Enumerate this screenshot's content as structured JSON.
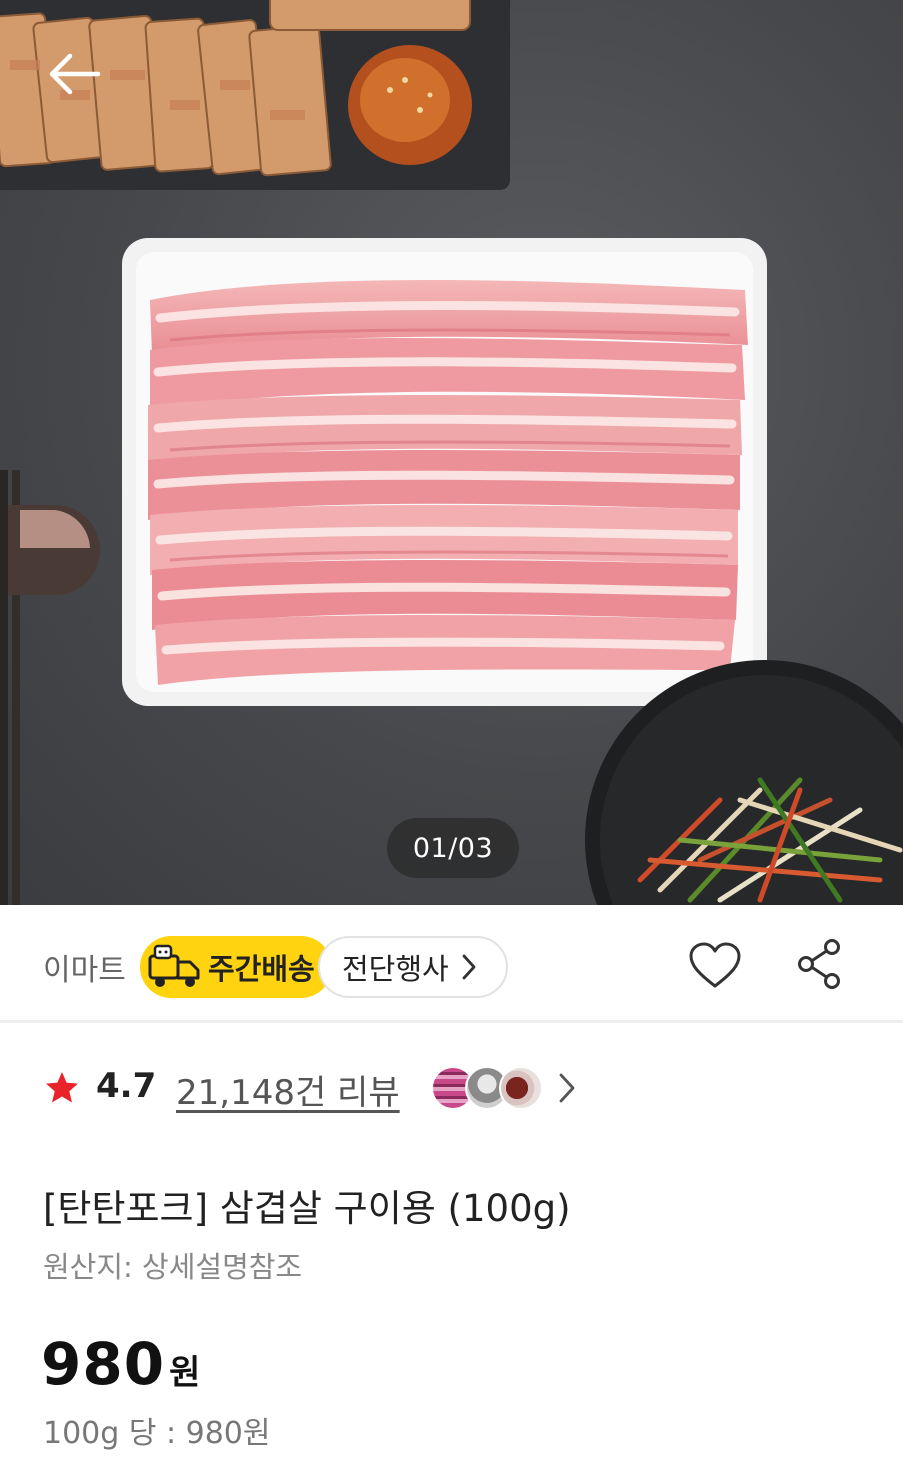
{
  "hero": {
    "image_counter": "01/03",
    "back_icon": "arrow-left-icon"
  },
  "store": {
    "name": "이마트",
    "delivery_badge": "주간배송",
    "event_badge": "전단행사",
    "wishlist_icon": "heart-icon",
    "share_icon": "share-icon"
  },
  "rating": {
    "score": "4.7",
    "reviews_label": "21,148건 리뷰",
    "star_color": "#e8242a"
  },
  "product": {
    "title": "[탄탄포크] 삼겹살 구이용 (100g)",
    "origin": "원산지: 상세설명참조",
    "price_number": "980",
    "price_unit": "원",
    "unit_price": "100g 당 : 980원"
  },
  "colors": {
    "badge_yellow": "#ffd30f",
    "divider": "#efefef"
  }
}
